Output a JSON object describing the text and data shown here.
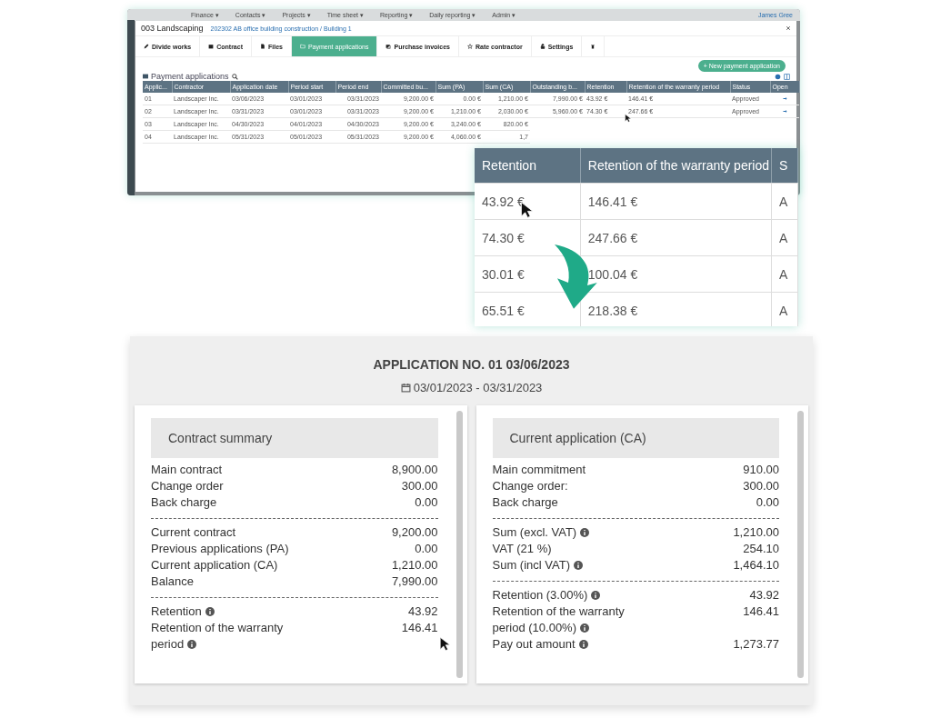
{
  "background_app": {
    "nav": [
      "Finance ▾",
      "Contacts ▾",
      "Projects ▾",
      "Time sheet ▾",
      "Reporting ▾",
      "Daily reporting ▾",
      "Admin ▾"
    ],
    "user": "James Gree"
  },
  "dialog": {
    "title": "003 Landscaping",
    "breadcrumb": "202302 AB office building construction / Building 1",
    "tabs": [
      {
        "label": "Divide works",
        "selected": false
      },
      {
        "label": "Contract",
        "selected": false
      },
      {
        "label": "Files",
        "selected": false
      },
      {
        "label": "Payment applications",
        "selected": true
      },
      {
        "label": "Purchase invoices",
        "selected": false
      },
      {
        "label": "Rate contractor",
        "selected": false
      },
      {
        "label": "Settings",
        "selected": false
      },
      {
        "selected": false
      }
    ],
    "new_button": "+ New payment application",
    "section_title": "Payment applications",
    "columns": [
      "Applic...",
      "Contractor",
      "Application date",
      "Period start",
      "Period end",
      "Committed bu...",
      "Sum (PA)",
      "Sum (CA)",
      "Outstanding b...",
      "Retention",
      "Retention of the warranty period",
      "Status",
      "Open"
    ],
    "rows": [
      {
        "cells": [
          "01",
          "Landscaper Inc.",
          "03/06/2023",
          "03/01/2023",
          "03/31/2023",
          "9,200.00 €",
          "0.00 €",
          "1,210.00 €",
          "7,990.00 €",
          "43.92 €",
          "146.41 €",
          "Approved"
        ],
        "open_link": true
      },
      {
        "cells": [
          "02",
          "Landscaper Inc.",
          "03/31/2023",
          "03/01/2023",
          "03/31/2023",
          "9,200.00 €",
          "1,210.00 €",
          "2,030.00 €",
          "5,960.00 €",
          "74.30 €",
          "247.66 €",
          "Approved"
        ],
        "open_link": true
      },
      {
        "cells": [
          "03",
          "Landscaper Inc.",
          "04/30/2023",
          "04/01/2023",
          "04/30/2023",
          "9,200.00 €",
          "3,240.00 €",
          "820.00 €"
        ],
        "open_link": false
      },
      {
        "cells": [
          "04",
          "Landscaper Inc.",
          "05/31/2023",
          "05/01/2023",
          "05/31/2023",
          "9,200.00 €",
          "4,060.00 €",
          "1,7"
        ],
        "open_link": false
      }
    ]
  },
  "zoom_panel": {
    "columns": [
      "Retention",
      "Retention of the warranty period",
      "S"
    ],
    "rows": [
      [
        "43.92 €",
        "146.41 €",
        "A"
      ],
      [
        "74.30 €",
        "247.66 €",
        "A"
      ],
      [
        "30.01 €",
        "100.04 €",
        "A"
      ],
      [
        "65.51 €",
        "218.38 €",
        "A"
      ]
    ]
  },
  "application": {
    "title": "APPLICATION NO. 01 03/06/2023",
    "period": "03/01/2023 - 03/31/2023",
    "cards": [
      {
        "title": "Contract summary",
        "groups": [
          [
            {
              "label": "Main contract",
              "value": "8,900.00",
              "info": false
            },
            {
              "label": "Change order",
              "value": "300.00",
              "info": false
            },
            {
              "label": "Back charge",
              "value": "0.00",
              "info": false
            }
          ],
          [
            {
              "label": "Current contract",
              "value": "9,200.00",
              "info": false
            },
            {
              "label": "Previous applications (PA)",
              "value": "0.00",
              "info": false
            },
            {
              "label": "Current application (CA)",
              "value": "1,210.00",
              "info": false
            },
            {
              "label": "Balance",
              "value": "7,990.00",
              "info": false
            }
          ],
          [
            {
              "label": "Retention",
              "value": "43.92",
              "info": true
            },
            {
              "label": "Retention of the warranty period",
              "value": "146.41",
              "info": true
            }
          ]
        ]
      },
      {
        "title": "Current application (CA)",
        "groups": [
          [
            {
              "label": "Main commitment",
              "value": "910.00",
              "info": false
            },
            {
              "label": "Change order:",
              "value": "300.00",
              "info": false
            },
            {
              "label": "Back charge",
              "value": "0.00",
              "info": false
            }
          ],
          [
            {
              "label": "Sum (excl. VAT)",
              "value": "1,210.00",
              "info": true
            },
            {
              "label": "VAT (21 %)",
              "value": "254.10",
              "info": false
            },
            {
              "label": "Sum (incl VAT)",
              "value": "1,464.10",
              "info": true
            }
          ],
          [
            {
              "label": "Retention (3.00%)",
              "value": "43.92",
              "info": true
            },
            {
              "label": "Retention of the warranty period (10.00%)",
              "value": "146.41",
              "info": true
            },
            {
              "label": "Pay out amount",
              "value": "1,273.77",
              "info": true
            }
          ]
        ]
      }
    ]
  }
}
